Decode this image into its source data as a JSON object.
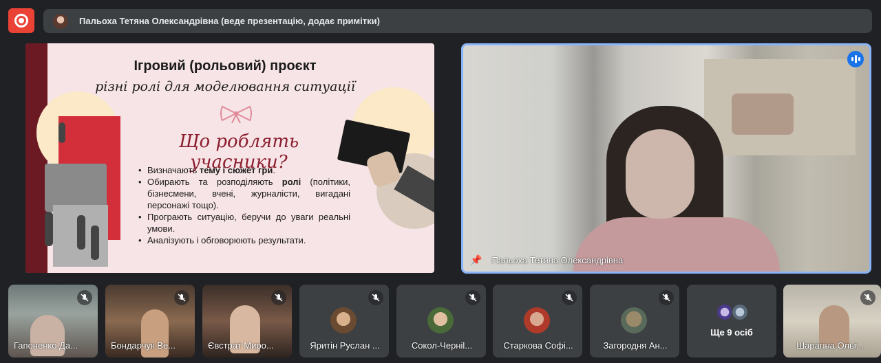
{
  "presenter_bar": {
    "text": "Пальоха Тетяна Олександрівна (веде презентацію, додає примітки)"
  },
  "slide": {
    "title": "Ігровий (рольовий) проєкт",
    "subtitle": "різні ролі для моделювання ситуації",
    "question": "Що роблять учасники?",
    "bullets": [
      {
        "pre": "Визначають ",
        "bold": "тему і сюжет гри",
        "post": "."
      },
      {
        "pre": "Обирають та розподіляють ",
        "bold": "ролі",
        "post": " (політики, бізнесмени, вчені, журналісти, вигадані персонажі тощо)."
      },
      {
        "pre": "Програють ситуацію, беручи до уваги реальні умови.",
        "bold": "",
        "post": ""
      },
      {
        "pre": "Аналізують і обговорюють результати.",
        "bold": "",
        "post": ""
      }
    ]
  },
  "main_video": {
    "name": "Пальоха Тетяна Олександрівна"
  },
  "participants": [
    {
      "name": "Гапоненко Да..."
    },
    {
      "name": "Бондарчук Ве..."
    },
    {
      "name": "Євстрат Миро..."
    },
    {
      "name": "Яритін Руслан ..."
    },
    {
      "name": "Сокол-Чернil..."
    },
    {
      "name": "Старкова Софі..."
    },
    {
      "name": "Загородня Ан..."
    },
    {
      "name": "Ще 9 осіб"
    },
    {
      "name": "Шарагіна Ольг..."
    }
  ],
  "colors": {
    "accent_blue": "#1a73e8",
    "record_red": "#ea4335",
    "slide_maroon": "#8b1e2e"
  },
  "icons": [
    "record-icon",
    "mic-off-icon",
    "pin-icon",
    "speaking-indicator-icon"
  ]
}
